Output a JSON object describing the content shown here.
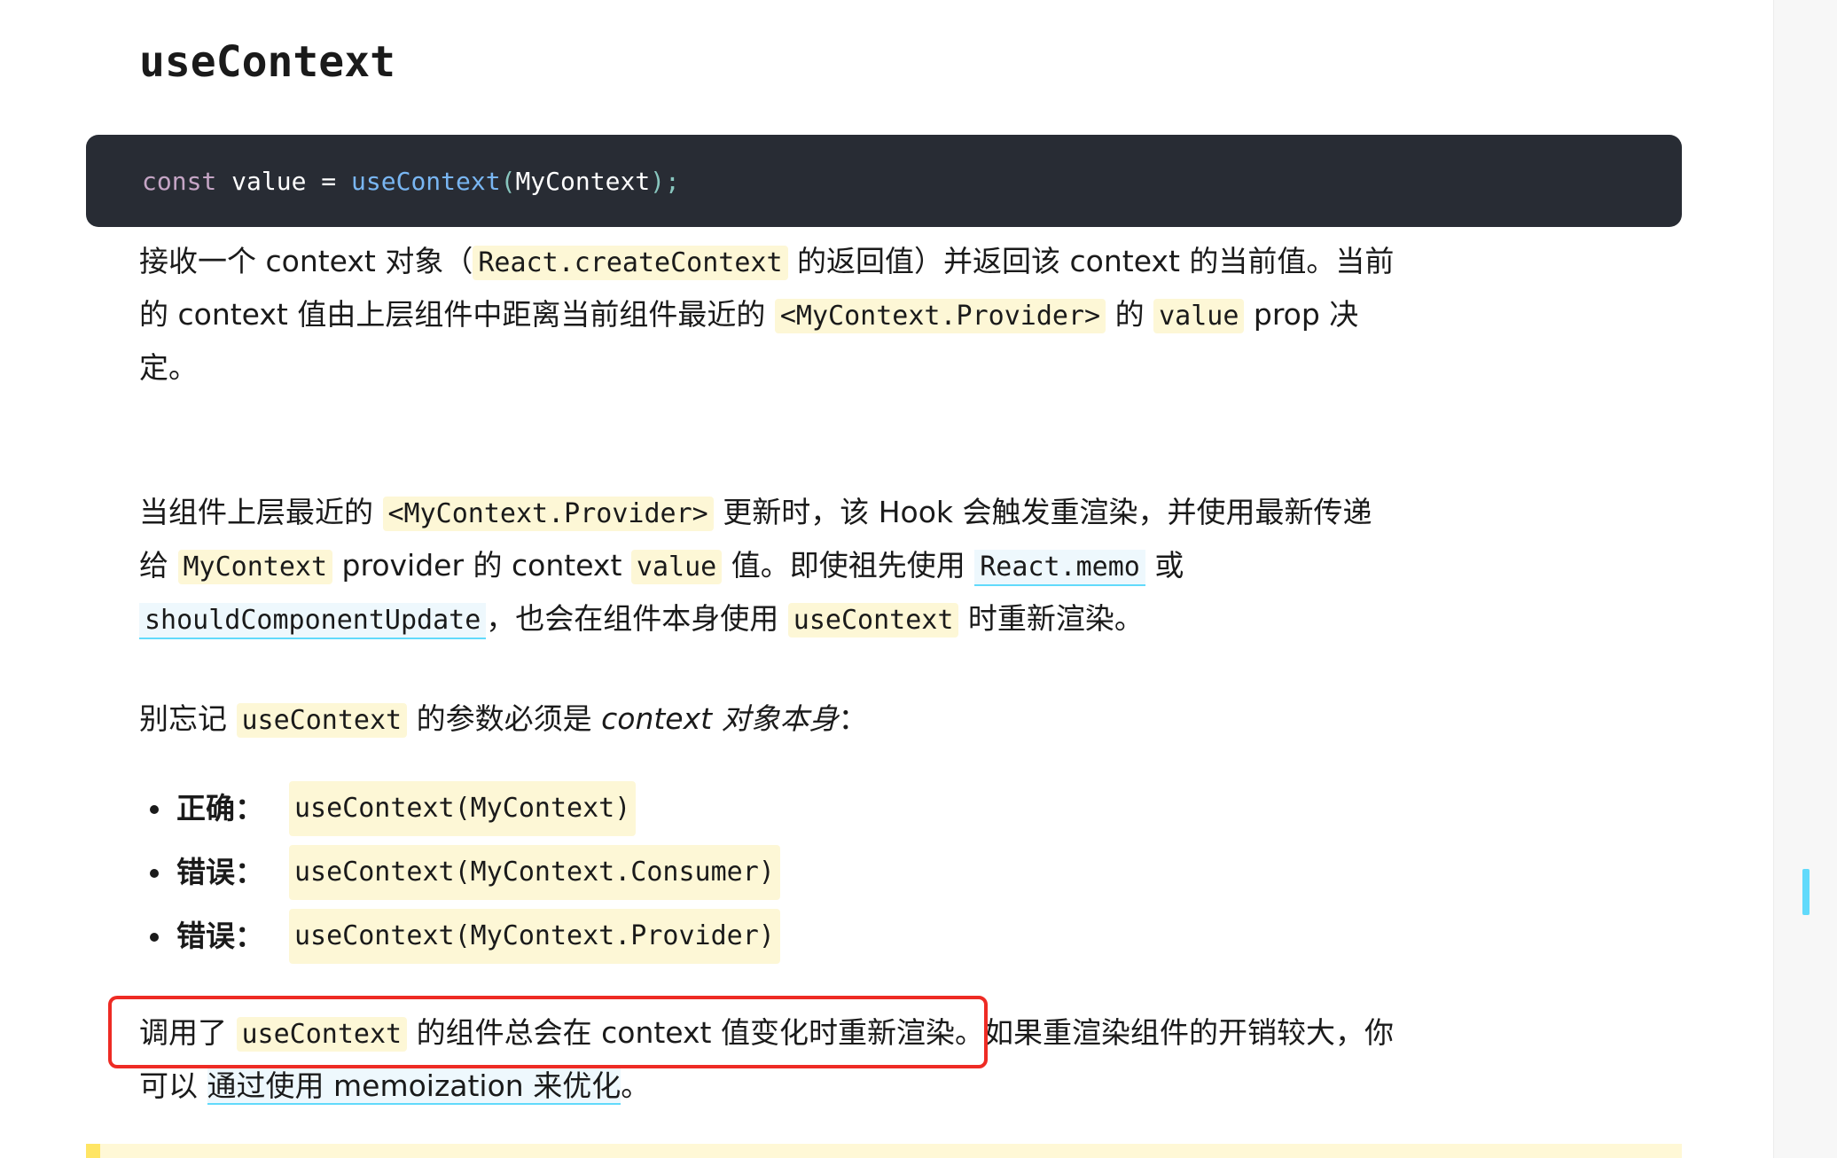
{
  "heading": "useContext",
  "code_block": {
    "kw": "const",
    "var": " value = ",
    "fn": "useContext",
    "open": "(",
    "arg": "MyContext",
    "close": ");"
  },
  "para1": {
    "t1": "接收一个 context 对象（",
    "c1": "React.createContext",
    "t2": " 的返回值）并返回该 context 的当前值。当前的 context 值由上层组件中距离当前组件最近的 ",
    "c2": "<MyContext.Provider>",
    "t3": " 的 ",
    "c3": "value",
    "t4": " prop 决定。"
  },
  "para2": {
    "t1": "当组件上层最近的 ",
    "c1": "<MyContext.Provider>",
    "t2": " 更新时，该 Hook 会触发重渲染，并使用最新传递给 ",
    "c2": "MyContext",
    "t3": " provider 的 context ",
    "c3": "value",
    "t4": " 值。即使祖先使用 ",
    "l1": "React.memo",
    "t5": " 或 ",
    "l2": "shouldComponentUpdate",
    "t6": "，也会在组件本身使用 ",
    "c4": "useContext",
    "t7": " 时重新渲染。"
  },
  "para3": {
    "t1": "别忘记 ",
    "c1": "useContext",
    "t2": " 的参数必须是",
    "em": " context 对象本身",
    "t3": "："
  },
  "bullets": [
    {
      "label": "正确：",
      "code": "useContext(MyContext)"
    },
    {
      "label": "错误：",
      "code": "useContext(MyContext.Consumer)"
    },
    {
      "label": "错误：",
      "code": "useContext(MyContext.Provider)"
    }
  ],
  "para4": {
    "t1": "调用了 ",
    "c1": "useContext",
    "t2": " 的组件总会在 context 值变化时重新渲染。如果重渲染组件的开销较大，你可以 ",
    "link": "通过使用 memoization 来优化",
    "t3": "。"
  },
  "colors": {
    "code_bg": "#282c34",
    "inline_code_bg": "#fdf7d6",
    "link_underline": "#61dafb",
    "highlight_border": "#ee2b24",
    "note_bg": "#fff8d6"
  }
}
